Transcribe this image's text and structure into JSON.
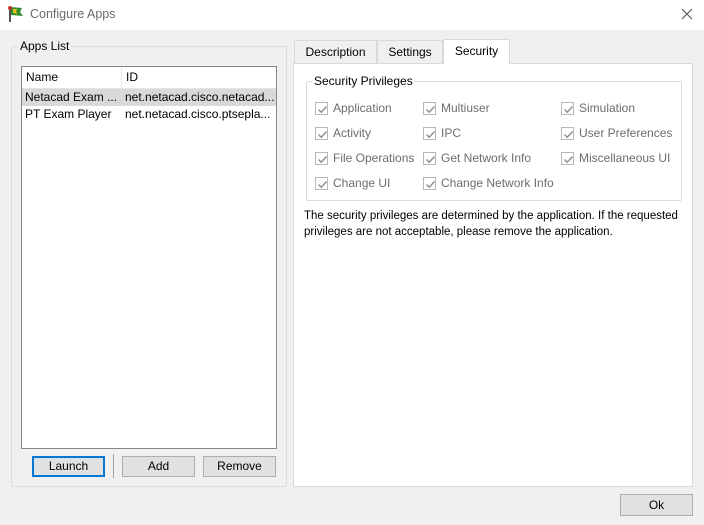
{
  "window": {
    "title": "Configure Apps",
    "colors": {
      "accent": "#0078d7",
      "selected_row": "#d9d9d9"
    }
  },
  "apps": {
    "legend": "Apps List",
    "columns": {
      "name": "Name",
      "id": "ID"
    },
    "rows": [
      {
        "name": "Netacad Exam ...",
        "id": "net.netacad.cisco.netacad...."
      },
      {
        "name": "PT Exam Player",
        "id": "net.netacad.cisco.ptsepla..."
      }
    ],
    "buttons": {
      "launch": "Launch",
      "add": "Add",
      "remove": "Remove"
    }
  },
  "tabs": {
    "description": "Description",
    "settings": "Settings",
    "security": "Security",
    "active": "Security"
  },
  "security": {
    "legend": "Security Privileges",
    "privileges": [
      {
        "label": "Application",
        "checked": true
      },
      {
        "label": "Multiuser",
        "checked": true
      },
      {
        "label": "Simulation",
        "checked": true
      },
      {
        "label": "Activity",
        "checked": true
      },
      {
        "label": "IPC",
        "checked": true
      },
      {
        "label": "User Preferences",
        "checked": true
      },
      {
        "label": "File Operations",
        "checked": true
      },
      {
        "label": "Get Network Info",
        "checked": true
      },
      {
        "label": "Miscellaneous UI",
        "checked": true
      },
      {
        "label": "Change UI",
        "checked": true
      },
      {
        "label": "Change Network Info",
        "checked": true
      }
    ],
    "note": "The security privileges are determined by the application. If the requested privileges are not acceptable, please remove the application."
  },
  "footer": {
    "ok": "Ok"
  }
}
